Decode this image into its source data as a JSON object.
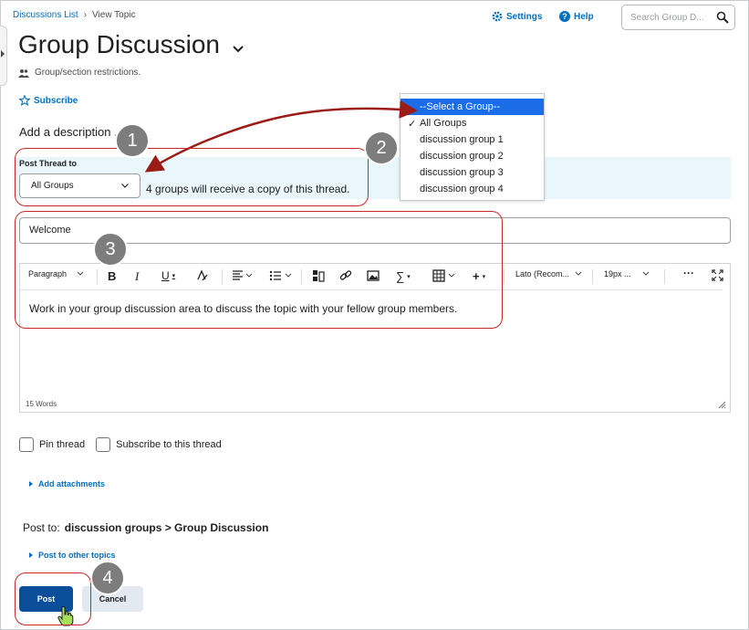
{
  "breadcrumb": {
    "link": "Discussions List",
    "separator": "›",
    "current": "View Topic"
  },
  "header": {
    "settings_label": "Settings",
    "help_label": "Help",
    "search_placeholder": "Search Group D..."
  },
  "page": {
    "title": "Group Discussion",
    "restriction_text": "Group/section restrictions.",
    "subscribe_label": "Subscribe",
    "add_description": "Add a description ..."
  },
  "post_thread": {
    "label": "Post Thread to",
    "selected": "All Groups",
    "note": "4 groups will receive a copy of this thread."
  },
  "dropdown": {
    "options": [
      "--Select a Group--",
      "All Groups",
      "discussion group 1",
      "discussion group 2",
      "discussion group 3",
      "discussion group 4"
    ],
    "check_mark": "✓"
  },
  "thread": {
    "subject": "Welcome",
    "body": "Work in your group discussion area to discuss the topic with your fellow group members.",
    "word_count": "15 Words"
  },
  "toolbar": {
    "paragraph": "Paragraph",
    "font": "Lato (Recom...",
    "size": "19px ..."
  },
  "options": {
    "pin_label": "Pin thread",
    "subscribe_label": "Subscribe to this thread"
  },
  "attachments": {
    "label": "Add attachments"
  },
  "post_to": {
    "prefix": "Post to:",
    "path": "discussion groups > Group Discussion",
    "other_label": "Post to other topics"
  },
  "actions": {
    "post_label": "Post",
    "cancel_label": "Cancel"
  },
  "annotations": {
    "n1": "1",
    "n2": "2",
    "n3": "3",
    "n4": "4"
  },
  "colors": {
    "link": "#006fbf",
    "primary_button": "#0a4d99",
    "highlight": "#1a6ce7",
    "annotation_red": "#c8282a",
    "annotation_arrow": "#9b1c16",
    "band": "#e9f6fc"
  }
}
